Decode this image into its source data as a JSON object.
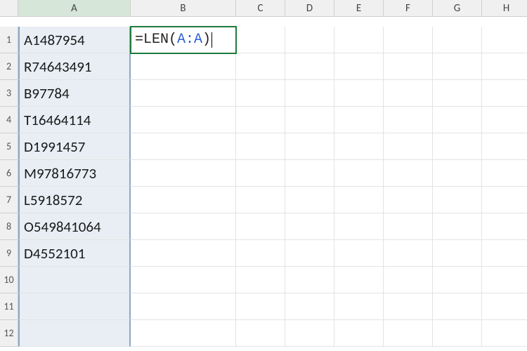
{
  "columns": [
    "A",
    "B",
    "C",
    "D",
    "E",
    "F",
    "G",
    "H"
  ],
  "rows": [
    1,
    2,
    3,
    4,
    5,
    6,
    7,
    8,
    9,
    10,
    11,
    12
  ],
  "columnA": [
    "A1487954",
    "R74643491",
    "B97784",
    "T16464114",
    "D1991457",
    "M97816773",
    "L5918572",
    "O549841064",
    "D4552101",
    "",
    "",
    ""
  ],
  "activeCell": {
    "address": "B1",
    "formula_prefix": "=LEN(",
    "formula_ref": "A:A",
    "formula_suffix": ")"
  },
  "selectedColumn": "A"
}
